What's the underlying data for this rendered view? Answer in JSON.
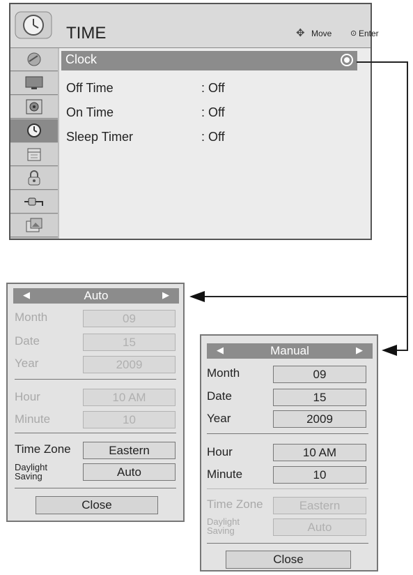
{
  "main_menu": {
    "title": "TIME",
    "hints": {
      "move": "Move",
      "enter": "Enter"
    },
    "sidebar_icons": [
      "satellite-dish-icon",
      "tv-screen-icon",
      "speaker-icon",
      "clock-icon",
      "calendar-icon",
      "lock-icon",
      "plug-icon",
      "photo-icon"
    ],
    "selected_sidebar_index": 3,
    "items": [
      {
        "label": "Clock",
        "value": ""
      },
      {
        "label": "Off Time",
        "value": ": Off"
      },
      {
        "label": "On Time",
        "value": ": Off"
      },
      {
        "label": "Sleep Timer",
        "value": ": Off"
      }
    ]
  },
  "auto_panel": {
    "mode": "Auto",
    "rows": [
      {
        "label": "Month",
        "value": "09"
      },
      {
        "label": "Date",
        "value": "15"
      },
      {
        "label": "Year",
        "value": "2009"
      },
      {
        "label": "Hour",
        "value": "10 AM"
      },
      {
        "label": "Minute",
        "value": "10"
      },
      {
        "label": "Time Zone",
        "value": "Eastern"
      },
      {
        "label": "Daylight Saving",
        "value": "Auto"
      }
    ],
    "close": "Close"
  },
  "manual_panel": {
    "mode": "Manual",
    "rows": [
      {
        "label": "Month",
        "value": "09"
      },
      {
        "label": "Date",
        "value": "15"
      },
      {
        "label": "Year",
        "value": "2009"
      },
      {
        "label": "Hour",
        "value": "10 AM"
      },
      {
        "label": "Minute",
        "value": "10"
      },
      {
        "label": "Time Zone",
        "value": "Eastern"
      },
      {
        "label": "Daylight Saving",
        "value": "Auto"
      }
    ],
    "close": "Close"
  }
}
